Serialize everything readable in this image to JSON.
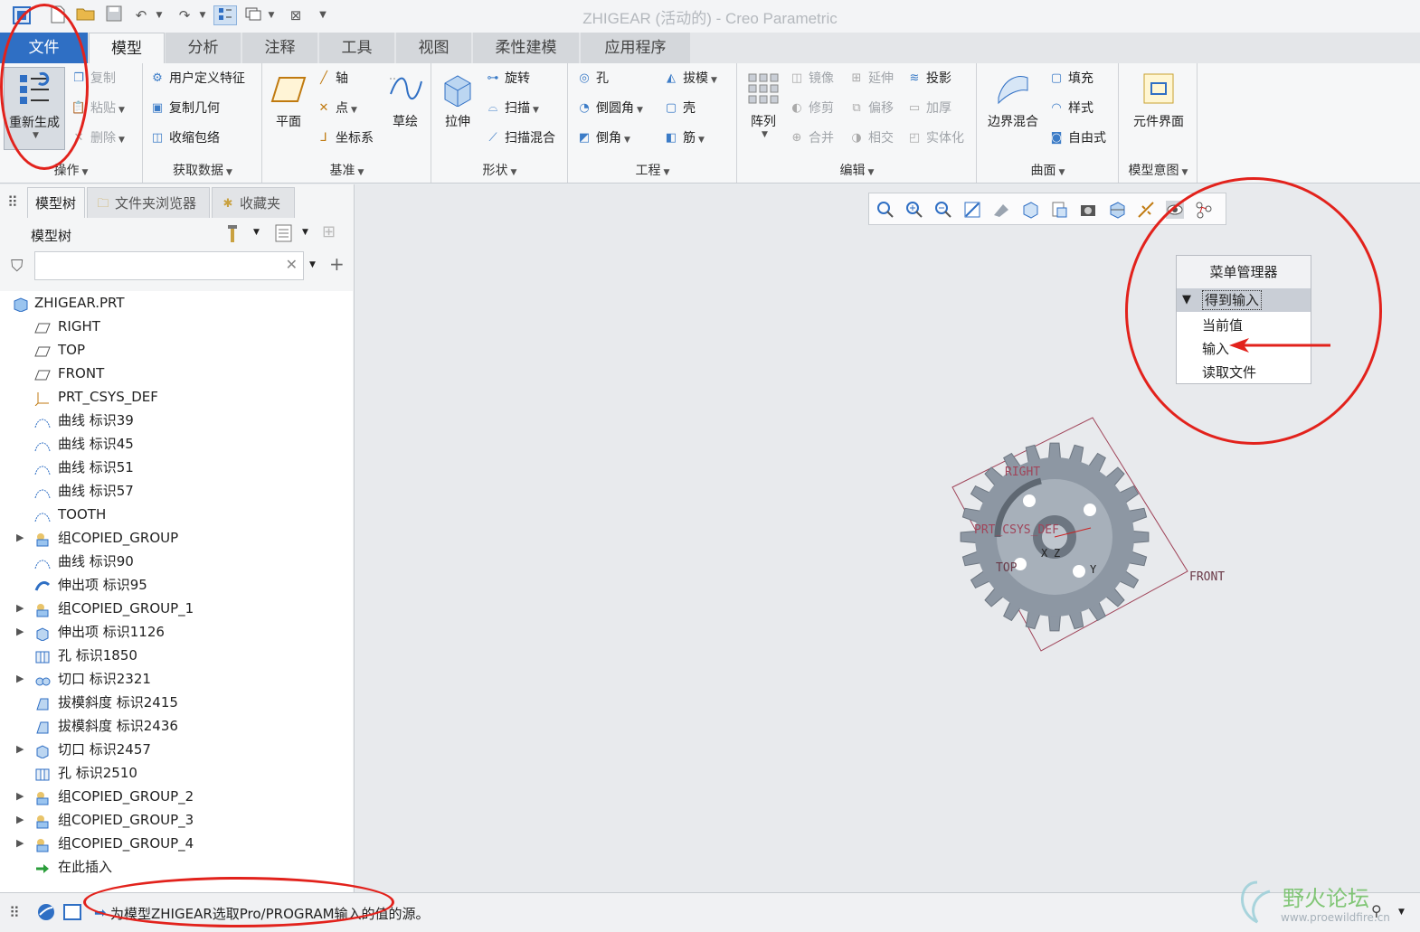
{
  "window": {
    "title": "ZHIGEAR (活动的) - Creo Parametric"
  },
  "tabs": [
    "文件",
    "模型",
    "分析",
    "注释",
    "工具",
    "视图",
    "柔性建模",
    "应用程序"
  ],
  "ribbon": {
    "operations": {
      "label": "操作",
      "regen": "重新生成",
      "copy": "复制",
      "paste": "粘贴",
      "delete": "删除"
    },
    "get_data": {
      "label": "获取数据",
      "udf": "用户定义特征",
      "copy_geom": "复制几何",
      "shrinkwrap": "收缩包络"
    },
    "datum": {
      "label": "基准",
      "plane": "平面",
      "axis": "轴",
      "point": "点",
      "csys": "坐标系",
      "sketch": "草绘"
    },
    "shapes": {
      "label": "形状",
      "extrude": "拉伸",
      "revolve": "旋转",
      "sweep": "扫描",
      "swept_blend": "扫描混合"
    },
    "engineering": {
      "label": "工程",
      "hole": "孔",
      "round": "倒圆角",
      "chamfer": "倒角",
      "draft": "拔模",
      "shell": "壳",
      "rib": "筋"
    },
    "editing": {
      "label": "编辑",
      "pattern": "阵列",
      "mirror": "镜像",
      "extend": "延伸",
      "project": "投影",
      "trim": "修剪",
      "offset": "偏移",
      "thicken": "加厚",
      "merge": "合并",
      "intersect": "相交",
      "solidify": "实体化"
    },
    "surfaces": {
      "label": "曲面",
      "boundary_blend": "边界混合",
      "fill": "填充",
      "style": "样式",
      "freestyle": "自由式"
    },
    "model_intent": {
      "label": "模型意图",
      "component_interface": "元件界面"
    }
  },
  "panel_tabs": [
    "模型树",
    "文件夹浏览器",
    "收藏夹"
  ],
  "model_tree": {
    "header": "模型树",
    "search_placeholder": "",
    "root": "ZHIGEAR.PRT",
    "items": [
      {
        "label": "RIGHT",
        "expand": false,
        "icon": "datum-plane-icon"
      },
      {
        "label": "TOP",
        "expand": false,
        "icon": "datum-plane-icon"
      },
      {
        "label": "FRONT",
        "expand": false,
        "icon": "datum-plane-icon"
      },
      {
        "label": "PRT_CSYS_DEF",
        "expand": false,
        "icon": "csys-icon"
      },
      {
        "label": "曲线 标识39",
        "expand": false,
        "icon": "curve-icon"
      },
      {
        "label": "曲线 标识45",
        "expand": false,
        "icon": "curve-icon"
      },
      {
        "label": "曲线 标识51",
        "expand": false,
        "icon": "curve-icon"
      },
      {
        "label": "曲线 标识57",
        "expand": false,
        "icon": "curve-icon"
      },
      {
        "label": "TOOTH",
        "expand": false,
        "icon": "curve-icon"
      },
      {
        "label": "组COPIED_GROUP",
        "expand": true,
        "icon": "group-icon"
      },
      {
        "label": "曲线 标识90",
        "expand": false,
        "icon": "curve-icon"
      },
      {
        "label": "伸出项 标识95",
        "expand": false,
        "icon": "protrusion-icon"
      },
      {
        "label": "组COPIED_GROUP_1",
        "expand": true,
        "icon": "group-icon"
      },
      {
        "label": "伸出项 标识1126",
        "expand": true,
        "icon": "extrude-icon"
      },
      {
        "label": "孔 标识1850",
        "expand": false,
        "icon": "hole-icon"
      },
      {
        "label": "切口 标识2321",
        "expand": true,
        "icon": "revolve-cut-icon"
      },
      {
        "label": "拔模斜度 标识2415",
        "expand": false,
        "icon": "draft-icon"
      },
      {
        "label": "拔模斜度 标识2436",
        "expand": false,
        "icon": "draft-icon"
      },
      {
        "label": "切口 标识2457",
        "expand": true,
        "icon": "extrude-icon"
      },
      {
        "label": "孔 标识2510",
        "expand": false,
        "icon": "hole-icon"
      },
      {
        "label": "组COPIED_GROUP_2",
        "expand": true,
        "icon": "group-icon"
      },
      {
        "label": "组COPIED_GROUP_3",
        "expand": true,
        "icon": "group-icon"
      },
      {
        "label": "组COPIED_GROUP_4",
        "expand": true,
        "icon": "group-icon"
      },
      {
        "label": "在此插入",
        "expand": false,
        "icon": "insert-arrow-icon"
      }
    ]
  },
  "menu_manager": {
    "title": "菜单管理器",
    "header": "得到输入",
    "items": [
      "当前值",
      "输入",
      "读取文件"
    ]
  },
  "viewport_labels": {
    "right": "RIGHT",
    "csys": "PRT_CSYS_DEF",
    "front": "FRONT",
    "top": "TOP",
    "x": "X",
    "y": "Y",
    "z": "Z"
  },
  "status": {
    "message": "为模型ZHIGEAR选取Pro/PROGRAM输入的值的源。"
  },
  "watermark": {
    "text": "野火论坛",
    "url": "www.proewildfire.cn"
  },
  "colors": {
    "file_tab": "#2f6fc4",
    "annotation": "#e2221c",
    "gear": "#8d97a3"
  }
}
